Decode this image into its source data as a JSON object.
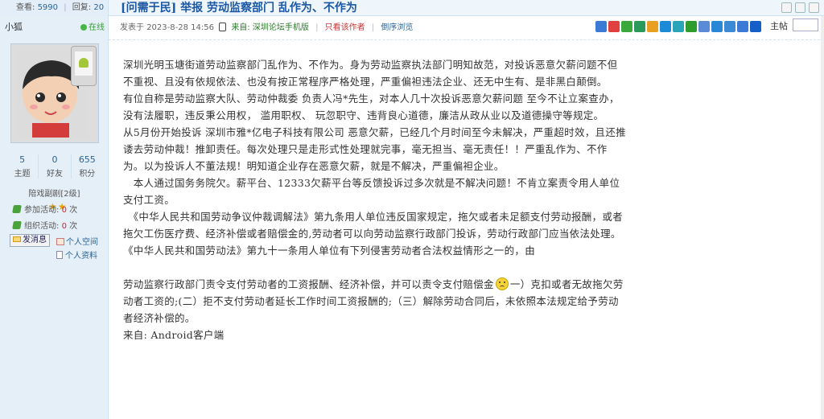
{
  "stats": {
    "views_label": "查看:",
    "views": "5990",
    "replies_label": "回复:",
    "replies": "20"
  },
  "thread": {
    "title": "[问需于民] 举报 劳动监察部门 乱作为、不作为"
  },
  "author": {
    "name": "小狐",
    "status": "在线",
    "stats": [
      {
        "value": "5",
        "label": "主题"
      },
      {
        "value": "0",
        "label": "好友"
      },
      {
        "value": "655",
        "label": "积分"
      }
    ],
    "rank": "陪戏副剧[2级]",
    "stars": 2,
    "activities": [
      {
        "label": "参加活动:",
        "count": "0",
        "unit": "次"
      },
      {
        "label": "组织活动:",
        "count": "0",
        "unit": "次"
      }
    ],
    "message_button": "发消息",
    "home_link": "个人空间",
    "profile_link": "个人资料"
  },
  "meta": {
    "posted_label": "发表于",
    "posted_at": "2023-8-28 14:56",
    "source": "来自: 深圳论坛手机版",
    "author_only": "只看该作者",
    "reverse": "倒序浏览",
    "floor_label": "主帖"
  },
  "share_icons": [
    {
      "name": "plus-icon",
      "color": "#3b7bd6"
    },
    {
      "name": "red-icon",
      "color": "#e04040"
    },
    {
      "name": "wechat-icon",
      "color": "#3aa83a"
    },
    {
      "name": "chat-icon",
      "color": "#2a9a5a"
    },
    {
      "name": "star-icon",
      "color": "#e8a020"
    },
    {
      "name": "p-icon",
      "color": "#1c8ad6"
    },
    {
      "name": "gem-icon",
      "color": "#2aa4b8"
    },
    {
      "name": "dou-icon",
      "color": "#2e9c2e"
    },
    {
      "name": "doc-icon",
      "color": "#5b8bd6"
    },
    {
      "name": "feather-icon",
      "color": "#2a86d6"
    },
    {
      "name": "plane-icon",
      "color": "#3a8ad6"
    },
    {
      "name": "plus2-icon",
      "color": "#3b7bd6"
    },
    {
      "name": "person-icon",
      "color": "#1560c8"
    }
  ],
  "post": {
    "paragraphs": [
      "深圳光明玉塘街道劳动监察部门乱作为、不作为。身为劳动监察执法部门明知故范，对投诉恶意欠薪问题不但不重视、且没有依规依法、也没有按正常程序严格处理，严重偏袒违法企业、还无中生有、是非黑白颠倒。",
      "有位自称是劳动监察大队、劳动仲裁委 负责人冯*先生，对本人几十次投诉恶意欠薪问题 至今不让立案查办，没有法履职，违反秉公用权， 滥用职权、 玩忽职守、违背良心道德，廉洁从政从业以及道德操守等规定。",
      "从5月份开始投诉 深圳市雅*亿电子科技有限公司 恶意欠薪，已经几个月时间至今未解决，严重超时效，且还推诿去劳动仲裁！推卸责任。每次处理只是走形式性处理就完事，毫无担当、毫无责任！！严重乱作为、不作为。以为投诉人不董法规！明知道企业存在恶意欠薪，就是不解决，严重偏袒企业。",
      "　本人通过国务务院欠。薪平台、12333欠薪平台等反馈投诉过多次就是不解决问题！不肯立案责令用人单位支付工资。",
      "　《中华人民共和国劳动争议仲裁调解法》第九条用人单位违反国家规定，拖欠或者未足额支付劳动报酬，或者拖欠工伤医疗费、经济补偿或者赔偿金的,劳动者可以向劳动监察行政部门投诉，劳动行政部门应当依法处理。《中华人民共和国劳动法》第九十一条用人单位有下列侵害劳动者合法权益情形之一的，由"
    ],
    "para_after_gap_1": "劳动监察行政部门责令支付劳动者的工资报酬、经济补偿，并可以责令支付赔偿金",
    "para_after_gap_2": "一）克扣或者无故拖欠劳动者工资的;(二）拒不支付劳动者延长工作时间工资报酬的;（三）解除劳动合同后，未依照本法规定给予劳动者经济补偿的。",
    "footer": "来自: Android客户端"
  }
}
